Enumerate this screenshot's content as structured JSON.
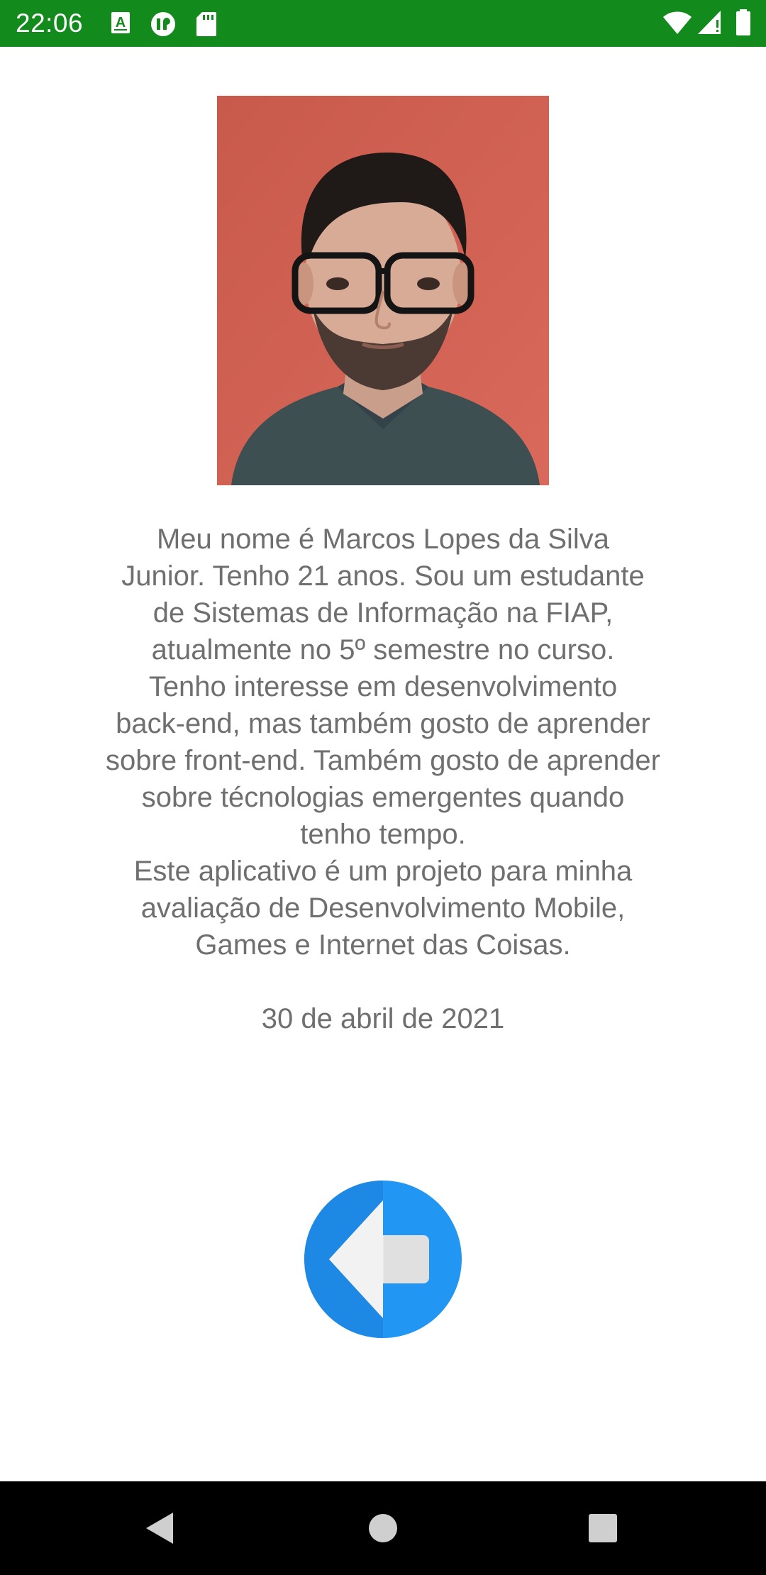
{
  "status_bar": {
    "time": "22:06",
    "background_color": "#128a1c",
    "icons_left": [
      "keyboard-a-icon",
      "app-notification-icon",
      "sd-card-icon"
    ],
    "icons_right": [
      "wifi-icon",
      "cellular-signal-icon",
      "battery-icon"
    ]
  },
  "profile": {
    "photo_icon": "profile-photo",
    "about": "Meu nome é Marcos Lopes da Silva\nJunior. Tenho 21 anos. Sou um estudante\nde Sistemas de Informação na FIAP,\natualmente no 5º semestre no curso.\nTenho interesse em desenvolvimento\nback-end, mas também gosto de aprender\nsobre front-end. Também gosto de aprender\nsobre técnologias emergentes quando\ntenho tempo.\nEste aplicativo é um projeto para minha\navaliação de Desenvolvimento Mobile,\nGames e Internet das Coisas.",
    "date": "30 de abril de 2021"
  },
  "back_button": {
    "icon": "back-arrow-icon",
    "colors": {
      "left_half": "#1e88e5",
      "right_half": "#2196f3",
      "arrow_left": "#f2f2f2",
      "arrow_right": "#e0e0e0"
    }
  },
  "nav_bar": {
    "buttons": [
      "nav-back-icon",
      "nav-home-icon",
      "nav-recents-icon"
    ],
    "button_color": "#cfcfcf"
  }
}
